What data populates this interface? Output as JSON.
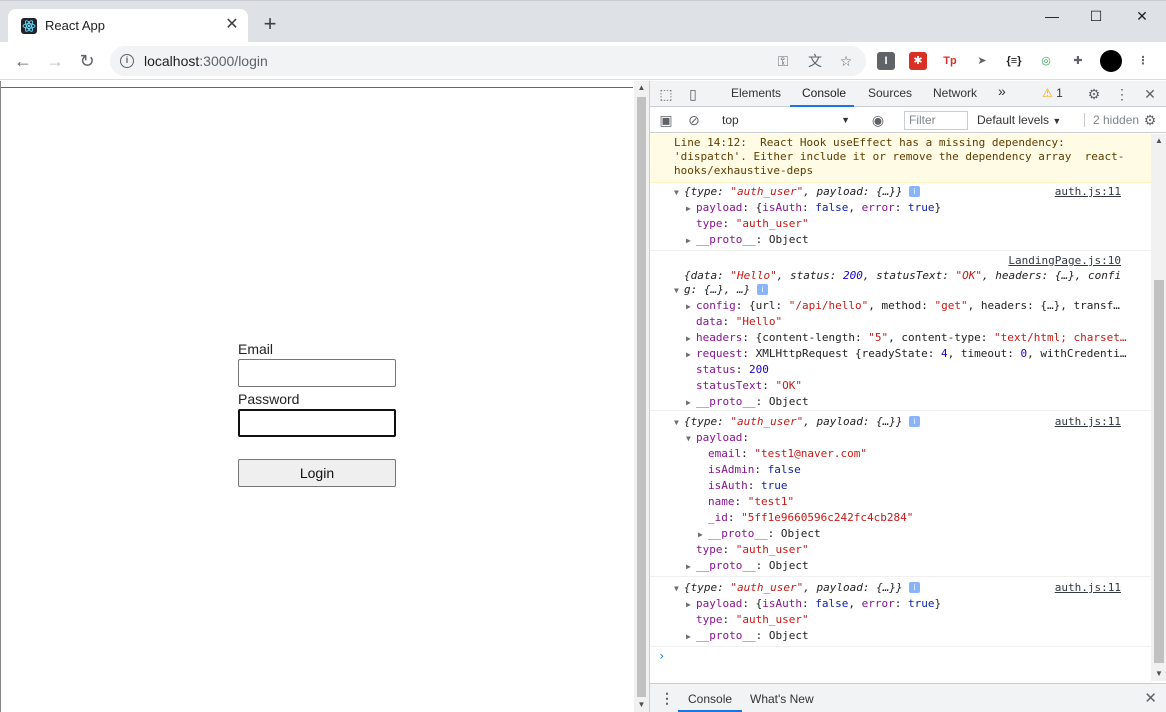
{
  "browser": {
    "tab_title": "React App",
    "url_host": "localhost",
    "url_path": ":3000/login",
    "icons": [
      "back-icon",
      "forward-icon",
      "reload-icon",
      "info-icon",
      "key-icon",
      "translate-icon",
      "star-icon",
      "extensions-icon",
      "menu-icon"
    ]
  },
  "page": {
    "email_label": "Email",
    "email_value": "",
    "password_label": "Password",
    "password_value": "",
    "login_button": "Login"
  },
  "devtools": {
    "tabs": [
      "Elements",
      "Console",
      "Sources",
      "Network"
    ],
    "active_tab": "Console",
    "more": "»",
    "warning_count": "1",
    "context": "top",
    "filter_placeholder": "Filter",
    "levels": "Default levels",
    "hidden": "2 hidden",
    "drawer_tabs": [
      "Console",
      "What's New"
    ]
  },
  "console": {
    "warning_lines": [
      "Line 14:12:  React Hook useEffect has a missing dependency:",
      "'dispatch'. Either include it or remove the dependency array  react-",
      "hooks/exhaustive-deps"
    ],
    "entries": [
      {
        "source": "auth.js:11",
        "summary": "{type: \"auth_user\", payload: {…}}",
        "lines": [
          "payload: {isAuth: false, error: true}",
          "type: \"auth_user\"",
          "__proto__: Object"
        ]
      },
      {
        "source": "LandingPage.js:10",
        "summary_1": "{data: \"Hello\", status: 200, statusText: \"OK\", headers: {…}, confi",
        "summary_2": "g: {…}, …}",
        "lines": [
          "config: {url: \"/api/hello\", method: \"get\", headers: {…}, transf…",
          "data: \"Hello\"",
          "headers: {content-length: \"5\", content-type: \"text/html; charset…",
          "request: XMLHttpRequest {readyState: 4, timeout: 0, withCredenti…",
          "status: 200",
          "statusText: \"OK\"",
          "__proto__: Object"
        ]
      },
      {
        "source": "auth.js:11",
        "summary": "{type: \"auth_user\", payload: {…}}",
        "lines": [
          "payload:",
          "email: \"test1@naver.com\"",
          "isAdmin: false",
          "isAuth: true",
          "name: \"test1\"",
          "_id: \"5ff1e9660596c242fc4cb284\"",
          "__proto__: Object",
          "type: \"auth_user\"",
          "__proto__: Object"
        ]
      },
      {
        "source": "auth.js:11",
        "summary": "{type: \"auth_user\", payload: {…}}",
        "lines": [
          "payload: {isAuth: false, error: true}",
          "type: \"auth_user\"",
          "__proto__: Object"
        ]
      }
    ]
  }
}
